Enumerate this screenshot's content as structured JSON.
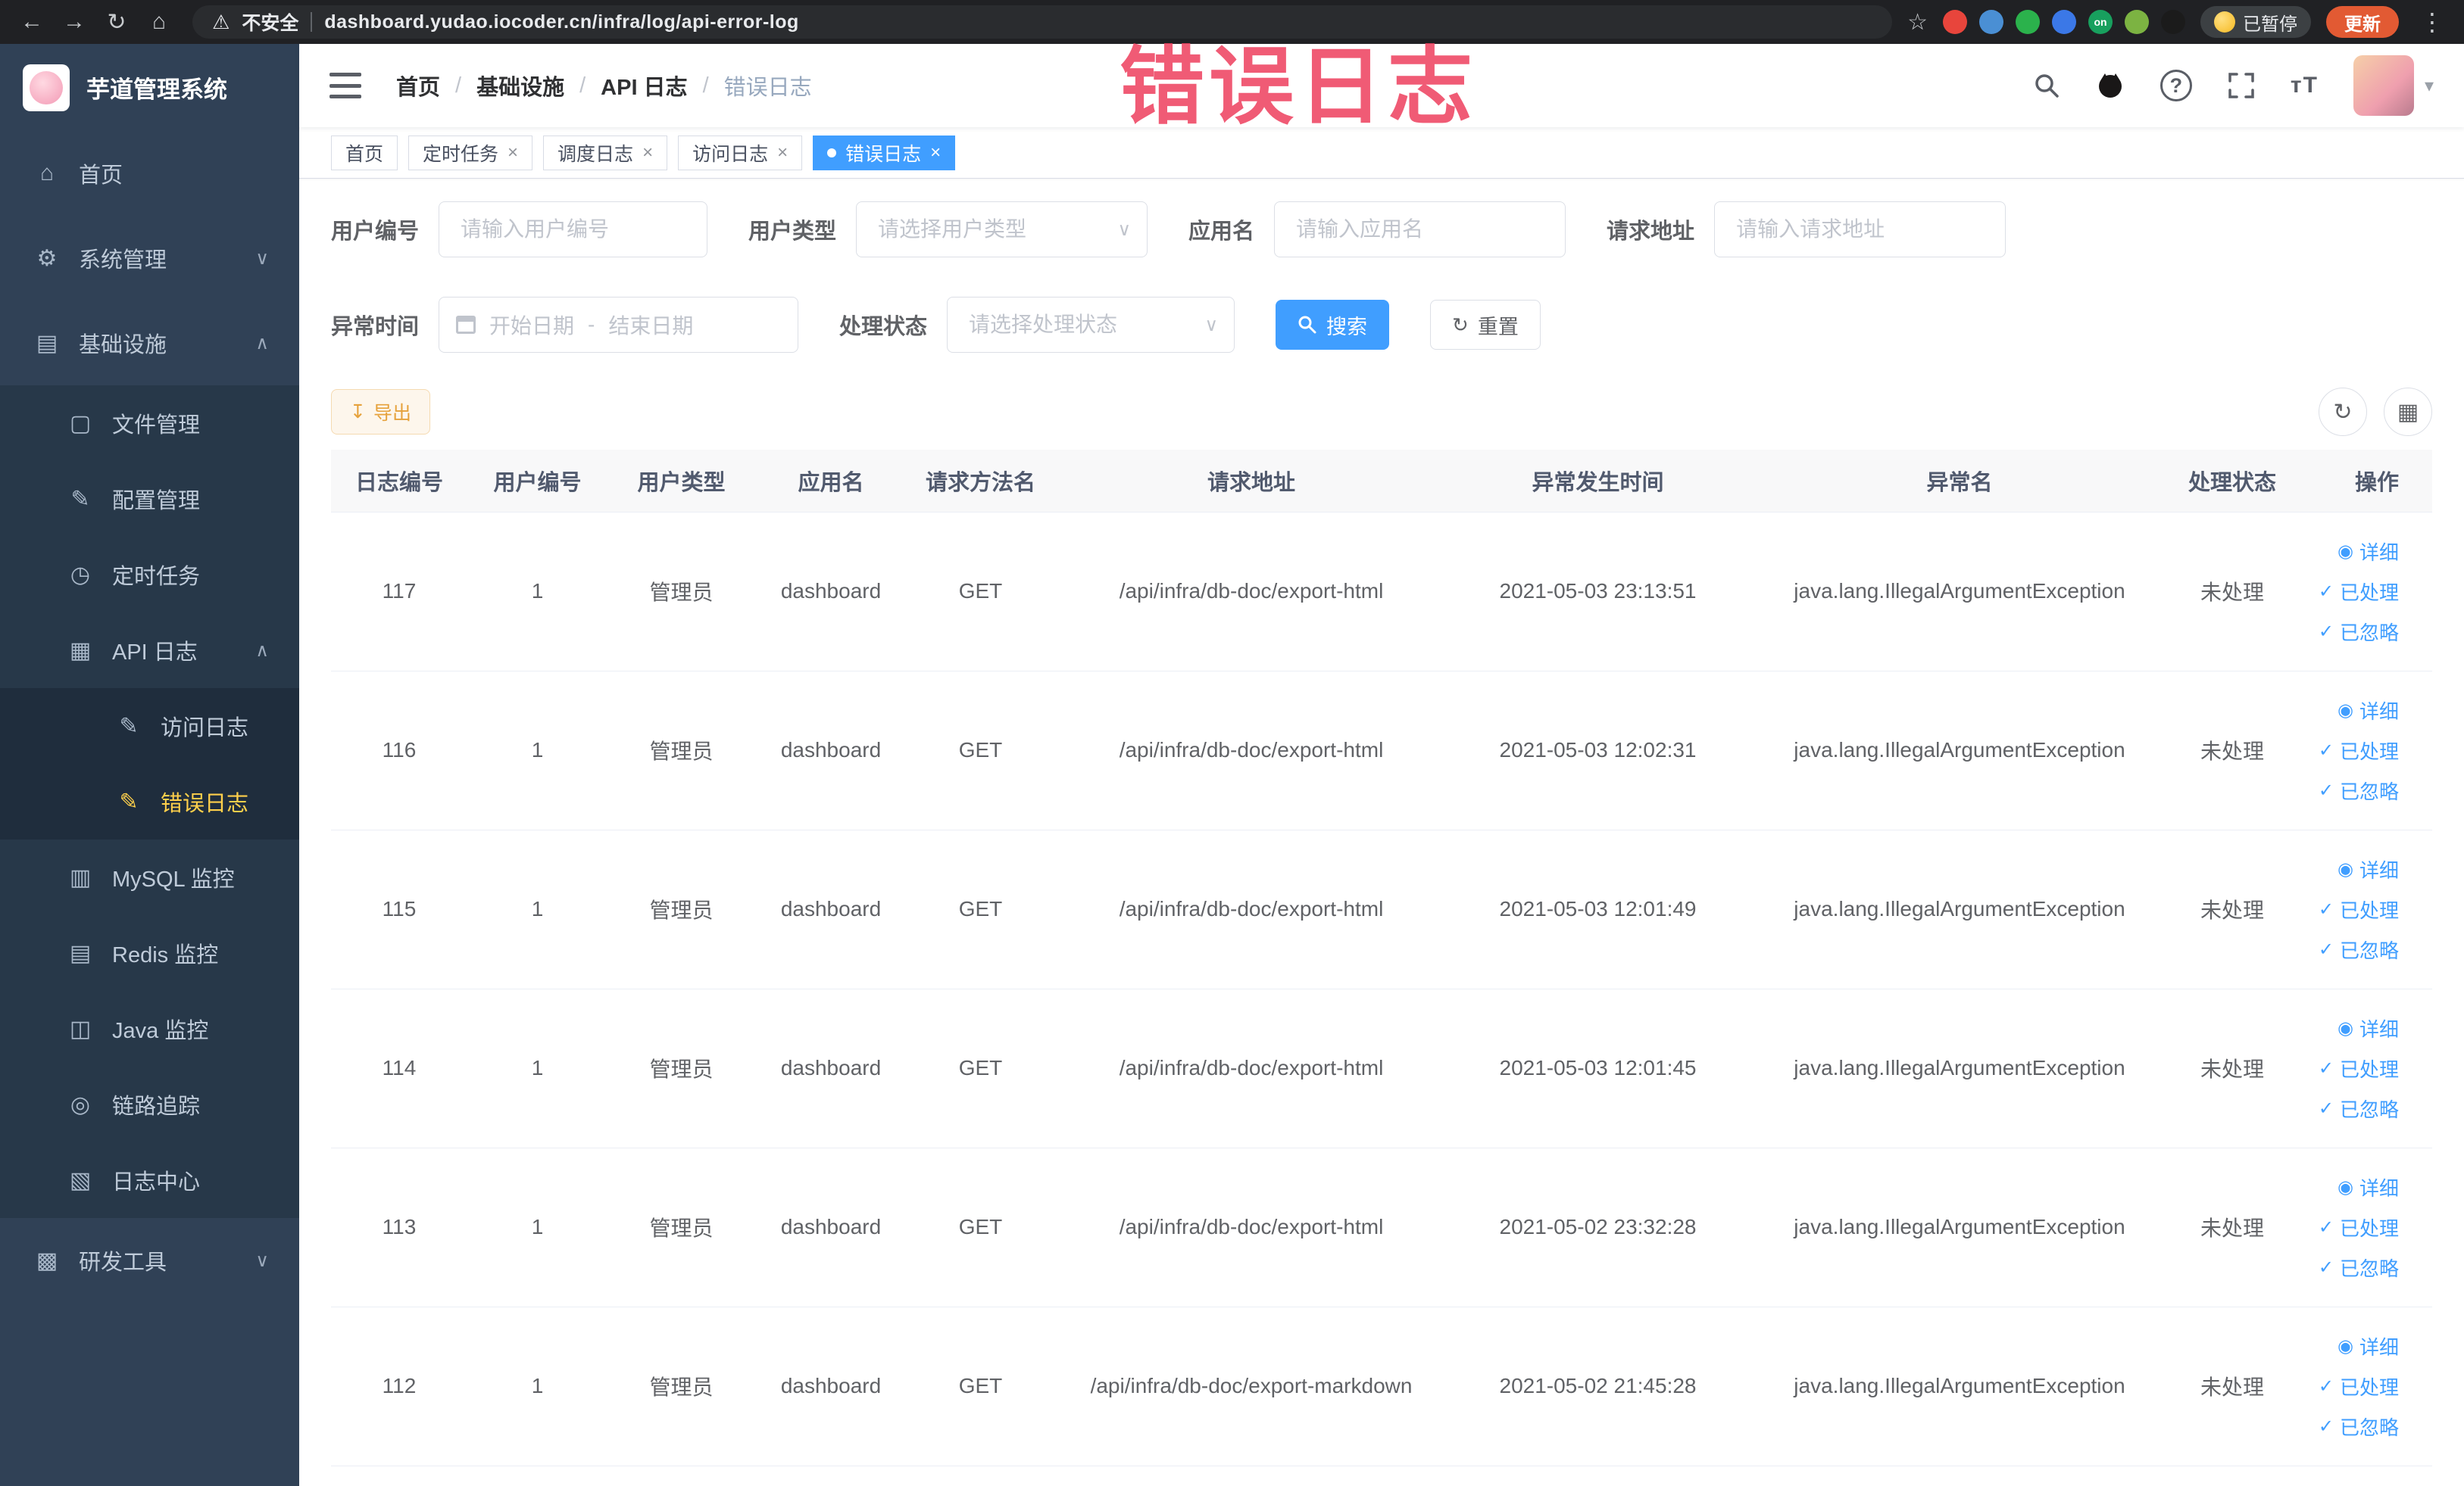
{
  "colors": {
    "primary": "#409EFF",
    "sidebar_bg": "#304156",
    "sidebar_sub_bg": "#1f2d3d",
    "active_menu": "#ffd04b",
    "warning": "#e6a23c",
    "watermark": "#ee3f5e"
  },
  "watermark": "错误日志",
  "browser": {
    "security_label": "不安全",
    "url": "dashboard.yudao.iocoder.cn/infra/log/api-error-log",
    "paused_label": "已暂停",
    "update_label": "更新",
    "extensions": [
      {
        "color": "#e8453c",
        "label": ""
      },
      {
        "color": "#4a8fd4",
        "label": ""
      },
      {
        "color": "#2bb24c",
        "label": ""
      },
      {
        "color": "#3b78e7",
        "label": ""
      },
      {
        "color": "#18a05e",
        "label": "on"
      },
      {
        "color": "#7cb342",
        "label": ""
      },
      {
        "color": "#1b1b1b",
        "label": ""
      }
    ]
  },
  "icons": {
    "back": "←",
    "forward": "→",
    "reload": "↻",
    "home_nav": "⌂",
    "star": "☆",
    "kebab": "⋮",
    "warning_glyph": "⚠",
    "caret_down": "▾",
    "question": "?",
    "text_size": "тT",
    "home": "⌂",
    "system": "⚙",
    "infra": "▤",
    "file": "▢",
    "config": "✎",
    "job": "◷",
    "apilog": "▦",
    "doc": "✎",
    "mysql": "▥",
    "redis": "▤",
    "java": "◫",
    "trace": "◎",
    "logcenter": "▧",
    "devtool": "▩",
    "chevron_up": "∧",
    "chevron_down": "∨",
    "eye": "◉",
    "check": "✓",
    "refresh": "↻",
    "grid": "▦",
    "export": "↧",
    "reset": "↻",
    "select_arrow": "∨"
  },
  "sidebar": {
    "logo_title": "芋道管理系统",
    "items": [
      {
        "id": "home",
        "label": "首页",
        "level": 1,
        "icon": "home"
      },
      {
        "id": "system",
        "label": "系统管理",
        "level": 1,
        "icon": "system",
        "arrow": "down"
      },
      {
        "id": "infra",
        "label": "基础设施",
        "level": 1,
        "icon": "infra",
        "arrow": "up"
      },
      {
        "id": "file",
        "label": "文件管理",
        "level": 2,
        "icon": "file"
      },
      {
        "id": "config",
        "label": "配置管理",
        "level": 2,
        "icon": "config"
      },
      {
        "id": "job",
        "label": "定时任务",
        "level": 2,
        "icon": "job"
      },
      {
        "id": "api-log",
        "label": "API 日志",
        "level": 2,
        "icon": "apilog",
        "arrow": "up"
      },
      {
        "id": "access-log",
        "label": "访问日志",
        "level": 3,
        "icon": "doc"
      },
      {
        "id": "error-log",
        "label": "错误日志",
        "level": 3,
        "icon": "doc",
        "active": true
      },
      {
        "id": "mysql",
        "label": "MySQL 监控",
        "level": 2,
        "icon": "mysql"
      },
      {
        "id": "redis",
        "label": "Redis 监控",
        "level": 2,
        "icon": "redis"
      },
      {
        "id": "java",
        "label": "Java 监控",
        "level": 2,
        "icon": "java"
      },
      {
        "id": "trace",
        "label": "链路追踪",
        "level": 2,
        "icon": "trace"
      },
      {
        "id": "log-center",
        "label": "日志中心",
        "level": 2,
        "icon": "logcenter"
      },
      {
        "id": "dev-tools",
        "label": "研发工具",
        "level": 1,
        "icon": "devtool",
        "arrow": "down"
      }
    ]
  },
  "header": {
    "breadcrumb": [
      "首页",
      "基础设施",
      "API 日志",
      "错误日志"
    ],
    "separator": "/"
  },
  "tabs": [
    {
      "label": "首页",
      "closable": false,
      "active": false
    },
    {
      "label": "定时任务",
      "closable": true,
      "active": false
    },
    {
      "label": "调度日志",
      "closable": true,
      "active": false
    },
    {
      "label": "访问日志",
      "closable": true,
      "active": false
    },
    {
      "label": "错误日志",
      "closable": true,
      "active": true
    }
  ],
  "filters": {
    "user_id": {
      "label": "用户编号",
      "placeholder": "请输入用户编号"
    },
    "user_type": {
      "label": "用户类型",
      "placeholder": "请选择用户类型"
    },
    "app_name": {
      "label": "应用名",
      "placeholder": "请输入应用名"
    },
    "request_url": {
      "label": "请求地址",
      "placeholder": "请输入请求地址"
    },
    "exception_time": {
      "label": "异常时间",
      "start_placeholder": "开始日期",
      "separator": "-",
      "end_placeholder": "结束日期"
    },
    "process_status": {
      "label": "处理状态",
      "placeholder": "请选择处理状态"
    },
    "search_label": "搜索",
    "reset_label": "重置"
  },
  "toolbar": {
    "export_label": "导出"
  },
  "table": {
    "headers": [
      "日志编号",
      "用户编号",
      "用户类型",
      "应用名",
      "请求方法名",
      "请求地址",
      "异常发生时间",
      "异常名",
      "处理状态",
      "操作"
    ],
    "actions": [
      {
        "name": "detail",
        "label": "详细",
        "icon": "eye"
      },
      {
        "name": "processed",
        "label": "已处理",
        "icon": "check"
      },
      {
        "name": "ignored",
        "label": "已忽略",
        "icon": "check"
      }
    ],
    "rows": [
      {
        "id": "117",
        "user_id": "1",
        "user_type": "管理员",
        "app": "dashboard",
        "method": "GET",
        "url": "/api/infra/db-doc/export-html",
        "time": "2021-05-03 23:13:51",
        "exception": "java.lang.IllegalArgumentException",
        "status": "未处理"
      },
      {
        "id": "116",
        "user_id": "1",
        "user_type": "管理员",
        "app": "dashboard",
        "method": "GET",
        "url": "/api/infra/db-doc/export-html",
        "time": "2021-05-03 12:02:31",
        "exception": "java.lang.IllegalArgumentException",
        "status": "未处理"
      },
      {
        "id": "115",
        "user_id": "1",
        "user_type": "管理员",
        "app": "dashboard",
        "method": "GET",
        "url": "/api/infra/db-doc/export-html",
        "time": "2021-05-03 12:01:49",
        "exception": "java.lang.IllegalArgumentException",
        "status": "未处理"
      },
      {
        "id": "114",
        "user_id": "1",
        "user_type": "管理员",
        "app": "dashboard",
        "method": "GET",
        "url": "/api/infra/db-doc/export-html",
        "time": "2021-05-03 12:01:45",
        "exception": "java.lang.IllegalArgumentException",
        "status": "未处理"
      },
      {
        "id": "113",
        "user_id": "1",
        "user_type": "管理员",
        "app": "dashboard",
        "method": "GET",
        "url": "/api/infra/db-doc/export-html",
        "time": "2021-05-02 23:32:28",
        "exception": "java.lang.IllegalArgumentException",
        "status": "未处理"
      },
      {
        "id": "112",
        "user_id": "1",
        "user_type": "管理员",
        "app": "dashboard",
        "method": "GET",
        "url": "/api/infra/db-doc/export-markdown",
        "time": "2021-05-02 21:45:28",
        "exception": "java.lang.IllegalArgumentException",
        "status": "未处理"
      }
    ]
  }
}
